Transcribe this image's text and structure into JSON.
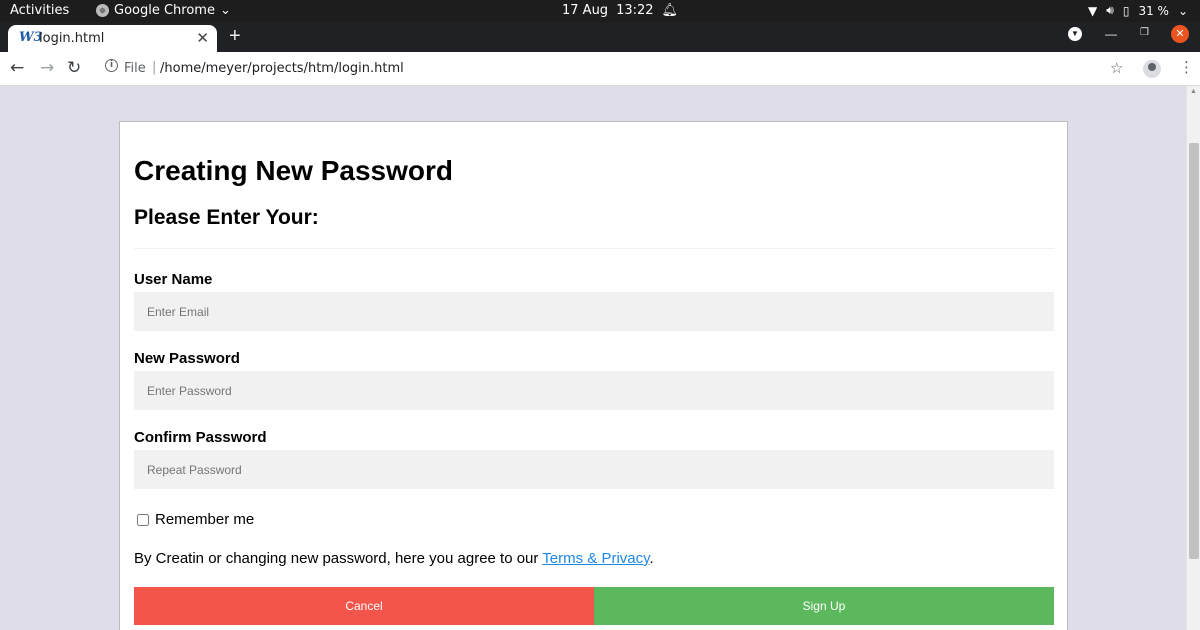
{
  "os": {
    "activities": "Activities",
    "app_name": "Google Chrome",
    "date": "17 Aug",
    "time": "13:22",
    "battery": "31 %"
  },
  "browser": {
    "tab_title": "login.html",
    "favicon_text": "W3",
    "scheme": "File",
    "url": "/home/meyer/projects/htm/login.html"
  },
  "form": {
    "title": "Creating New Password",
    "subtitle": "Please Enter Your:",
    "fields": [
      {
        "label": "User Name",
        "placeholder": "Enter Email"
      },
      {
        "label": "New Password",
        "placeholder": "Enter Password"
      },
      {
        "label": "Confirm Password",
        "placeholder": "Repeat Password"
      }
    ],
    "remember_label": "Remember me",
    "terms_prefix": "By Creatin or changing new password, here you agree to our ",
    "terms_link": "Terms & Privacy",
    "terms_suffix": ".",
    "cancel_label": "Cancel",
    "signup_label": "Sign Up",
    "cancel_color": "#f4554a",
    "signup_color": "#5cb85c",
    "link_color": "#1e88e5"
  }
}
